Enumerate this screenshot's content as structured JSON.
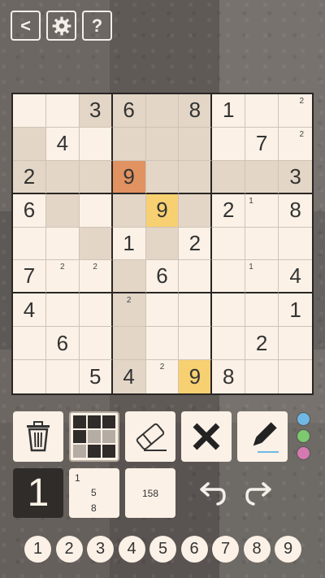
{
  "top_buttons": {
    "back": "<",
    "settings_icon": "gear-icon",
    "help": "?"
  },
  "board": {
    "selected": [
      2,
      3
    ],
    "cells": [
      [
        {
          "v": "",
          "n": []
        },
        {
          "v": "",
          "n": []
        },
        {
          "v": "3",
          "n": []
        },
        {
          "v": "6",
          "n": []
        },
        {
          "v": "",
          "n": []
        },
        {
          "v": "8",
          "n": []
        },
        {
          "v": "1",
          "n": []
        },
        {
          "v": "",
          "n": []
        },
        {
          "v": "",
          "n": [
            "2"
          ]
        }
      ],
      [
        {
          "v": "",
          "n": []
        },
        {
          "v": "4",
          "n": []
        },
        {
          "v": "",
          "n": []
        },
        {
          "v": "",
          "n": []
        },
        {
          "v": "",
          "n": []
        },
        {
          "v": "",
          "n": []
        },
        {
          "v": "",
          "n": []
        },
        {
          "v": "7",
          "n": []
        },
        {
          "v": "",
          "n": [
            "2"
          ]
        }
      ],
      [
        {
          "v": "2",
          "n": []
        },
        {
          "v": "",
          "n": []
        },
        {
          "v": "",
          "n": []
        },
        {
          "v": "9",
          "n": []
        },
        {
          "v": "",
          "n": []
        },
        {
          "v": "",
          "n": []
        },
        {
          "v": "",
          "n": []
        },
        {
          "v": "",
          "n": []
        },
        {
          "v": "3",
          "n": []
        }
      ],
      [
        {
          "v": "6",
          "n": []
        },
        {
          "v": "",
          "n": []
        },
        {
          "v": "",
          "n": []
        },
        {
          "v": "",
          "n": []
        },
        {
          "v": "9",
          "n": []
        },
        {
          "v": "",
          "n": []
        },
        {
          "v": "2",
          "n": []
        },
        {
          "v": "",
          "n": [
            "1"
          ]
        },
        {
          "v": "8",
          "n": []
        }
      ],
      [
        {
          "v": "",
          "n": []
        },
        {
          "v": "",
          "n": []
        },
        {
          "v": "",
          "n": []
        },
        {
          "v": "1",
          "n": []
        },
        {
          "v": "",
          "n": []
        },
        {
          "v": "2",
          "n": []
        },
        {
          "v": "",
          "n": []
        },
        {
          "v": "",
          "n": []
        },
        {
          "v": "",
          "n": []
        }
      ],
      [
        {
          "v": "7",
          "n": []
        },
        {
          "v": "",
          "n": [
            "2"
          ]
        },
        {
          "v": "",
          "n": [
            "2"
          ]
        },
        {
          "v": "",
          "n": []
        },
        {
          "v": "6",
          "n": []
        },
        {
          "v": "",
          "n": []
        },
        {
          "v": "",
          "n": []
        },
        {
          "v": "",
          "n": [
            "1"
          ]
        },
        {
          "v": "4",
          "n": []
        }
      ],
      [
        {
          "v": "4",
          "n": []
        },
        {
          "v": "",
          "n": []
        },
        {
          "v": "",
          "n": []
        },
        {
          "v": "",
          "n": [
            "2"
          ]
        },
        {
          "v": "",
          "n": []
        },
        {
          "v": "",
          "n": []
        },
        {
          "v": "",
          "n": []
        },
        {
          "v": "",
          "n": []
        },
        {
          "v": "1",
          "n": []
        }
      ],
      [
        {
          "v": "",
          "n": []
        },
        {
          "v": "6",
          "n": []
        },
        {
          "v": "",
          "n": []
        },
        {
          "v": "",
          "n": []
        },
        {
          "v": "",
          "n": []
        },
        {
          "v": "",
          "n": []
        },
        {
          "v": "",
          "n": []
        },
        {
          "v": "2",
          "n": []
        },
        {
          "v": "",
          "n": []
        }
      ],
      [
        {
          "v": "",
          "n": []
        },
        {
          "v": "",
          "n": []
        },
        {
          "v": "5",
          "n": []
        },
        {
          "v": "4",
          "n": []
        },
        {
          "v": "",
          "n": [
            "2"
          ]
        },
        {
          "v": "9",
          "n": []
        },
        {
          "v": "8",
          "n": []
        },
        {
          "v": "",
          "n": []
        },
        {
          "v": "",
          "n": []
        }
      ]
    ],
    "highlight_cells": [
      [
        0,
        3
      ],
      [
        0,
        4
      ],
      [
        0,
        5
      ],
      [
        1,
        3
      ],
      [
        1,
        4
      ],
      [
        1,
        5
      ],
      [
        2,
        0
      ],
      [
        2,
        1
      ],
      [
        2,
        2
      ],
      [
        2,
        4
      ],
      [
        2,
        5
      ],
      [
        2,
        6
      ],
      [
        2,
        7
      ],
      [
        2,
        8
      ],
      [
        3,
        1
      ],
      [
        3,
        3
      ],
      [
        3,
        5
      ],
      [
        4,
        2
      ],
      [
        4,
        4
      ],
      [
        5,
        3
      ],
      [
        6,
        3
      ],
      [
        7,
        3
      ],
      [
        8,
        3
      ],
      [
        1,
        0
      ],
      [
        0,
        2
      ]
    ],
    "same_value_cells": [
      [
        3,
        4
      ],
      [
        8,
        5
      ]
    ]
  },
  "tools": {
    "trash_icon": "trash-icon",
    "pattern_icon": "grid-pattern-icon",
    "eraser_icon": "eraser-icon",
    "clear_icon": "x-icon",
    "pen_icon": "pen-icon",
    "colors": [
      "#6fb8e6",
      "#7cc96f",
      "#d57ab1"
    ]
  },
  "modes": {
    "normal_label": "1",
    "corner_lines": [
      "1",
      "5",
      "8"
    ],
    "center_label": "158"
  },
  "actions": {
    "undo_icon": "undo-icon",
    "redo_icon": "redo-icon"
  },
  "numpad": [
    "1",
    "2",
    "3",
    "4",
    "5",
    "6",
    "7",
    "8",
    "9"
  ]
}
